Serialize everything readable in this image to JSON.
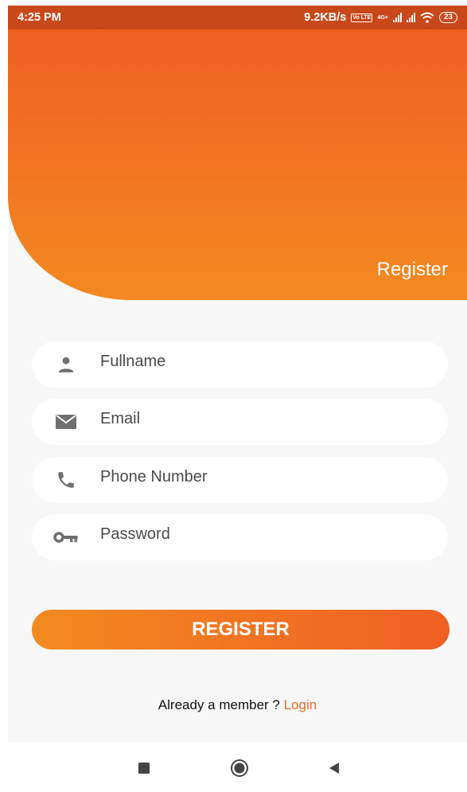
{
  "status_bar": {
    "time": "4:25 PM",
    "network_speed": "9.2KB/s",
    "volte_badge": "Vo LTE",
    "network_type": "4G+",
    "battery_level": "23"
  },
  "header": {
    "title": "Register"
  },
  "form": {
    "fields": [
      {
        "placeholder": "Fullname",
        "value": "",
        "icon": "person-icon"
      },
      {
        "placeholder": "Email",
        "value": "",
        "icon": "email-icon"
      },
      {
        "placeholder": "Phone Number",
        "value": "",
        "icon": "phone-icon"
      },
      {
        "placeholder": "Password",
        "value": "",
        "icon": "key-icon"
      }
    ],
    "submit_label": "REGISTER"
  },
  "footer": {
    "prompt": "Already a member ? ",
    "login_label": "Login"
  },
  "colors": {
    "accent_start": "#f05f22",
    "accent_end": "#f38a21",
    "status_bar": "#c8481a",
    "background": "#f7f7f7"
  },
  "navigation_bar": {
    "icons": [
      "recent-apps-icon",
      "home-icon",
      "back-icon"
    ]
  }
}
